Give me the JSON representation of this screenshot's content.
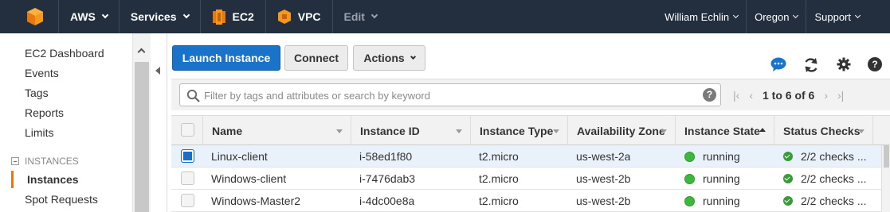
{
  "topbar": {
    "aws_label": "AWS",
    "services_label": "Services",
    "ec2_label": "EC2",
    "vpc_label": "VPC",
    "edit_label": "Edit",
    "user_label": "William Echlin",
    "region_label": "Oregon",
    "support_label": "Support"
  },
  "sidebar": {
    "items": [
      {
        "label": "EC2 Dashboard"
      },
      {
        "label": "Events"
      },
      {
        "label": "Tags"
      },
      {
        "label": "Reports"
      },
      {
        "label": "Limits"
      }
    ],
    "section_label": "INSTANCES",
    "sub_items": [
      {
        "label": "Instances"
      },
      {
        "label": "Spot Requests"
      }
    ]
  },
  "toolbar": {
    "launch_label": "Launch Instance",
    "connect_label": "Connect",
    "actions_label": "Actions"
  },
  "filter": {
    "placeholder": "Filter by tags and attributes or search by keyword",
    "pager_text": "1 to 6 of 6"
  },
  "table": {
    "columns": [
      "Name",
      "Instance ID",
      "Instance Type",
      "Availability Zone",
      "Instance State",
      "Status Checks"
    ],
    "rows": [
      {
        "name": "Linux-client",
        "id": "i-58ed1f80",
        "type": "t2.micro",
        "zone": "us-west-2a",
        "state": "running",
        "checks": "2/2 checks ...",
        "selected": true
      },
      {
        "name": "Windows-client",
        "id": "i-7476dab3",
        "type": "t2.micro",
        "zone": "us-west-2b",
        "state": "running",
        "checks": "2/2 checks ...",
        "selected": false
      },
      {
        "name": "Windows-Master2",
        "id": "i-4dc00e8a",
        "type": "t2.micro",
        "zone": "us-west-2b",
        "state": "running",
        "checks": "2/2 checks ...",
        "selected": false
      }
    ]
  },
  "colors": {
    "topbar_bg": "#232f3e",
    "primary_button": "#1a73c8",
    "running_green": "#3db83d",
    "active_nav_accent": "#e47911"
  }
}
